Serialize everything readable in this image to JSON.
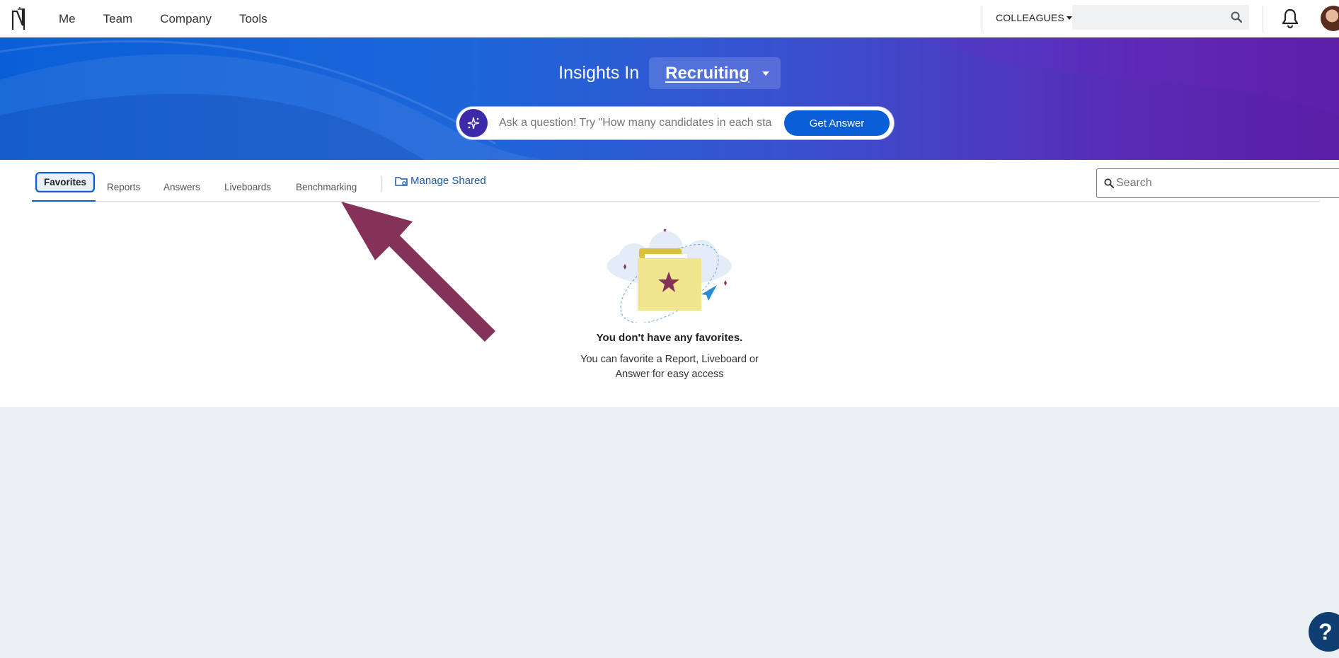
{
  "topnav": {
    "items": [
      "Me",
      "Team",
      "Company",
      "Tools"
    ],
    "colleagues_label": "COLLEAGUES",
    "search_placeholder": ""
  },
  "banner": {
    "insights_label": "Insights In",
    "module": "Recruiting",
    "ask_placeholder": "Ask a question! Try \"How many candidates in each sta",
    "get_answer_label": "Get Answer"
  },
  "tabs": {
    "items": [
      "Favorites",
      "Reports",
      "Answers",
      "Liveboards",
      "Benchmarking"
    ],
    "active": "Favorites",
    "manage_shared_label": "Manage Shared",
    "search_placeholder": "Search"
  },
  "empty_state": {
    "title": "You don't have any favorites.",
    "text": "You can favorite a Report, Liveboard or Answer for easy access"
  },
  "help": {
    "label": "?"
  },
  "colors": {
    "accent": "#0a5fd8",
    "banner_start": "#0a5fd8",
    "banner_end": "#5b1ea6",
    "arrow": "#84325a",
    "folder": "#f2e58f",
    "help_bg": "#0f3f72"
  }
}
